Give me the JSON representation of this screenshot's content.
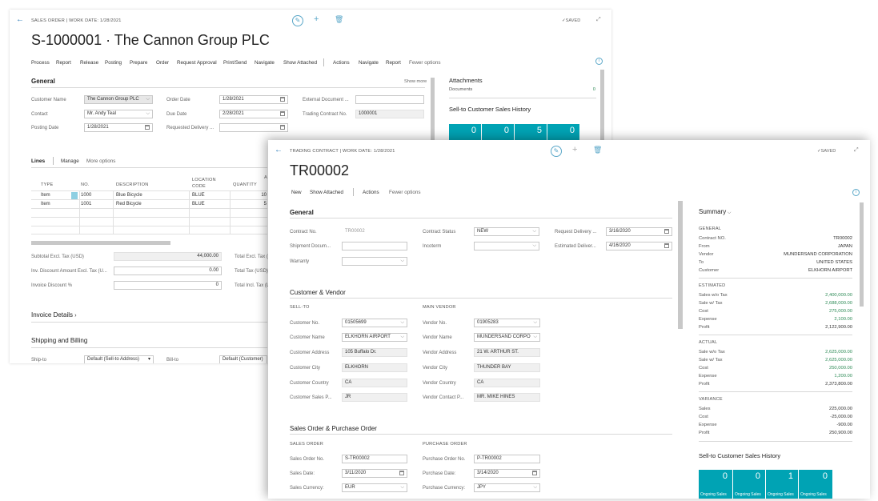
{
  "win1": {
    "header": "SALES ORDER | WORK DATE: 1/28/2021",
    "title": "S-1000001 · The Cannon Group PLC",
    "saved": "✓SAVED",
    "toolbar": [
      "Process",
      "Report",
      "Release",
      "Posting",
      "Prepare",
      "Order",
      "Request Approval",
      "Print/Send",
      "Navigate",
      "Show Attached",
      "Actions",
      "Navigate",
      "Report",
      "Fewer options"
    ],
    "general": {
      "title": "General",
      "show_more": "Show more",
      "customer_name_label": "Customer Name",
      "customer_name": "The Cannon Group PLC",
      "contact_label": "Contact",
      "contact": "Mr. Andy Teal",
      "posting_date_label": "Posting Date",
      "posting_date": "1/28/2021",
      "order_date_label": "Order Date",
      "order_date": "1/28/2021",
      "due_date_label": "Due Date",
      "due_date": "2/28/2021",
      "req_delivery_label": "Requested Delivery ...",
      "ext_doc_label": "External Document ...",
      "trading_contract_label": "Trading Contract No.",
      "trading_contract": "1000001"
    },
    "lines": {
      "tabs": [
        "Lines",
        "Manage",
        "More options"
      ],
      "headers": [
        "TYPE",
        "NO.",
        "DESCRIPTION",
        "LOCATION CODE",
        "QUANTITY"
      ],
      "rows": [
        [
          "Item",
          "1000",
          "Blue Bicycle",
          "BLUE",
          "10"
        ],
        [
          "Item",
          "1001",
          "Red Bicycle",
          "BLUE",
          "5"
        ]
      ]
    },
    "totals": {
      "subtotal_label": "Subtotal Excl. Tax (USD)",
      "subtotal": "44,000.00",
      "inv_disc_label": "Inv. Discount Amount Excl. Tax (U...",
      "inv_disc": "0.00",
      "inv_disc_pct_label": "Invoice Discount %",
      "inv_disc_pct": "0",
      "total_excl_label": "Total Excl. Tax (I",
      "total_tax_label": "Total Tax (USD)",
      "total_incl_label": "Total Incl. Tax (L"
    },
    "invoice_details": "Invoice Details",
    "shipping": {
      "title": "Shipping and Billing",
      "ship_to_label": "Ship-to",
      "ship_to": "Default (Sell-to Address)",
      "bill_to_label": "Bill-to",
      "bill_to": "Default (Customer)"
    },
    "factbox": {
      "attachments": "Attachments",
      "documents_label": "Documents",
      "documents": "0",
      "history": "Sell-to Customer Sales History",
      "tiles": [
        "0",
        "0",
        "5",
        "0"
      ]
    }
  },
  "win2": {
    "header": "TRADING CONTRACT | WORK DATE: 1/28/2021",
    "title": "TR00002",
    "saved": "✓SAVED",
    "toolbar": [
      "New",
      "Show Attached",
      "Actions",
      "Fewer options"
    ],
    "general": {
      "title": "General",
      "contract_no_label": "Contract No.",
      "contract_no": "TR00002",
      "shipment_label": "Shipment Docum...",
      "warranty_label": "Warranty",
      "status_label": "Contract Status",
      "status": "NEW",
      "incoterm_label": "Incoterm",
      "req_delivery_label": "Request Delivery ...",
      "req_delivery": "3/16/2020",
      "est_delivery_label": "Estimated Deliver...",
      "est_delivery": "4/16/2020"
    },
    "cv": {
      "title": "Customer & Vendor",
      "sell_to": "SELL-TO",
      "main_vendor": "MAIN VENDOR",
      "left": [
        [
          "Customer No.",
          "01505699"
        ],
        [
          "Customer Name",
          "ELKHORN AIRPORT"
        ],
        [
          "Customer Address",
          "105 Buffalo Dr."
        ],
        [
          "Customer City",
          "ELKHORN"
        ],
        [
          "Customer Country",
          "CA"
        ],
        [
          "Customer Sales P...",
          "JR"
        ]
      ],
      "right": [
        [
          "Vendor No.",
          "01905283"
        ],
        [
          "Vendor Name",
          "MUNDERSAND CORPO"
        ],
        [
          "Vendor Address",
          "21 W. ARTHUR ST."
        ],
        [
          "Vendor City",
          "THUNDER BAY"
        ],
        [
          "Vendor Country",
          "CA"
        ],
        [
          "Vendor Contact P...",
          "MR. MIKE HINES"
        ]
      ]
    },
    "sopo": {
      "title": "Sales Order & Purchase Order",
      "sales_order": "SALES ORDER",
      "purchase_order": "PURCHASE ORDER",
      "left": [
        [
          "Sales Order No.",
          "S-TR00002"
        ],
        [
          "Sales Date:",
          "3/11/2020"
        ],
        [
          "Sales Currency:",
          "EUR"
        ]
      ],
      "right": [
        [
          "Purchase Order No.",
          "P-TR00002"
        ],
        [
          "Purchase Date:",
          "3/14/2020"
        ],
        [
          "Purchase Currency:",
          "JPY"
        ]
      ]
    },
    "summary": {
      "title": "Summary",
      "general_title": "GENERAL",
      "general": [
        [
          "Contract NO.",
          "TR00002"
        ],
        [
          "From",
          "JAPAN"
        ],
        [
          "Vendor",
          "MUNDERSAND CORPORATION"
        ],
        [
          "To",
          "UNITED STATES"
        ],
        [
          "Customer",
          "ELKHORN AIRPORT"
        ]
      ],
      "estimated_title": "ESTIMATED",
      "estimated": [
        [
          "Sales w/o Tax",
          "2,400,000.00"
        ],
        [
          "Sale w/ Tax",
          "2,688,000.00"
        ],
        [
          "Cost",
          "275,000.00"
        ],
        [
          "Expense",
          "2,100.00"
        ],
        [
          "Profit",
          "2,122,900.00"
        ]
      ],
      "actual_title": "ACTUAL",
      "actual": [
        [
          "Sale w/o Tax",
          "2,625,000.00"
        ],
        [
          "Sale w/ Tax",
          "2,625,000.00"
        ],
        [
          "Cost",
          "250,000.00"
        ],
        [
          "Expense",
          "1,200.00"
        ],
        [
          "Profit",
          "2,373,800.00"
        ]
      ],
      "variance_title": "VARIANCE",
      "variance": [
        [
          "Sales",
          "225,000.00"
        ],
        [
          "Cost",
          "-25,000.00"
        ],
        [
          "Expense",
          "-900.00"
        ],
        [
          "Profit",
          "250,900.00"
        ]
      ],
      "history": "Sell-to Customer Sales History",
      "tiles": [
        [
          "0",
          "Ongoing Sales"
        ],
        [
          "0",
          "Ongoing Sales"
        ],
        [
          "1",
          "Ongoing Sales"
        ],
        [
          "0",
          "Ongoing Sales"
        ]
      ]
    }
  }
}
